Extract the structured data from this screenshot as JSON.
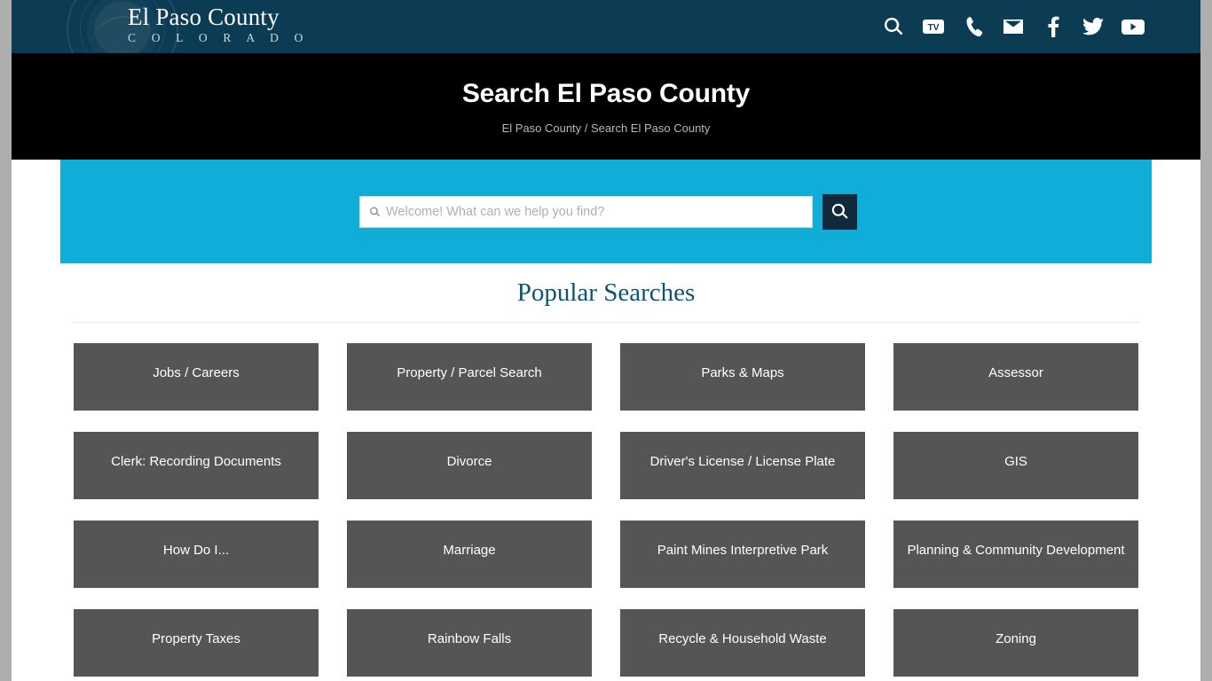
{
  "site": {
    "brand_main": "El Paso County",
    "brand_sub": "C O L O R A D O",
    "seal_icon": "county-seal-watermark"
  },
  "topbar": {
    "icons": [
      {
        "name": "search-icon",
        "label": "Search"
      },
      {
        "name": "tv-icon",
        "label": "TV",
        "glyph": "TV"
      },
      {
        "name": "phone-icon",
        "label": "Phone"
      },
      {
        "name": "mail-icon",
        "label": "Email"
      },
      {
        "name": "facebook-icon",
        "label": "Facebook"
      },
      {
        "name": "twitter-icon",
        "label": "Twitter"
      },
      {
        "name": "youtube-icon",
        "label": "YouTube"
      }
    ]
  },
  "hero": {
    "title": "Search El Paso County",
    "breadcrumb": "El Paso County / Search El Paso County"
  },
  "search": {
    "placeholder": "Welcome! What can we help you find?",
    "value": "",
    "submit_icon": "search-icon",
    "band_color": "#0fadd7",
    "submit_color": "#11293b"
  },
  "popular": {
    "heading": "Popular Searches",
    "heading_color": "#0b5574",
    "tile_color": "#555555",
    "tiles": [
      "Jobs / Careers",
      "Property / Parcel Search",
      "Parks & Maps",
      "Assessor",
      "Clerk: Recording Documents",
      "Divorce",
      "Driver's License / License Plate",
      "GIS",
      "How Do I...",
      "Marriage",
      "Paint Mines Interpretive Park",
      "Planning & Community Development",
      "Property Taxes",
      "Rainbow Falls",
      "Recycle & Household Waste",
      "Zoning"
    ]
  }
}
